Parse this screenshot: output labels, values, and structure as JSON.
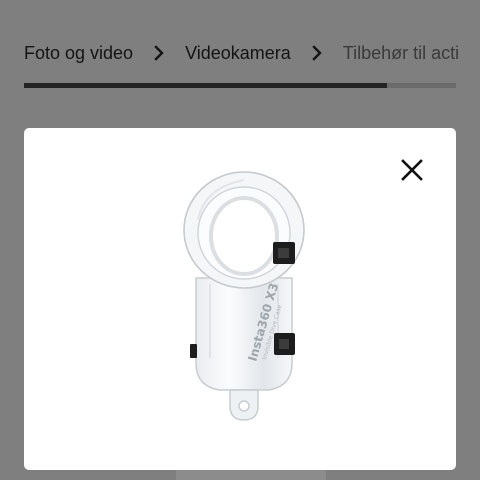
{
  "breadcrumb": {
    "items": [
      {
        "label": "Foto og video"
      },
      {
        "label": "Videokamera"
      },
      {
        "label": "Tilbehør til acti"
      }
    ],
    "separator_icon": "chevron-right-icon"
  },
  "carousel": {
    "progress_fraction": 0.84
  },
  "modal": {
    "close_icon": "close-icon",
    "product_image": {
      "label_line1": "Insta360 X3",
      "label_line2": "Invisible Dive Case"
    }
  },
  "colors": {
    "overlay": "#7f7f7f",
    "text": "#141414",
    "progress_fill": "#242424",
    "progress_track": "#6b6b6b",
    "modal_bg": "#ffffff"
  }
}
